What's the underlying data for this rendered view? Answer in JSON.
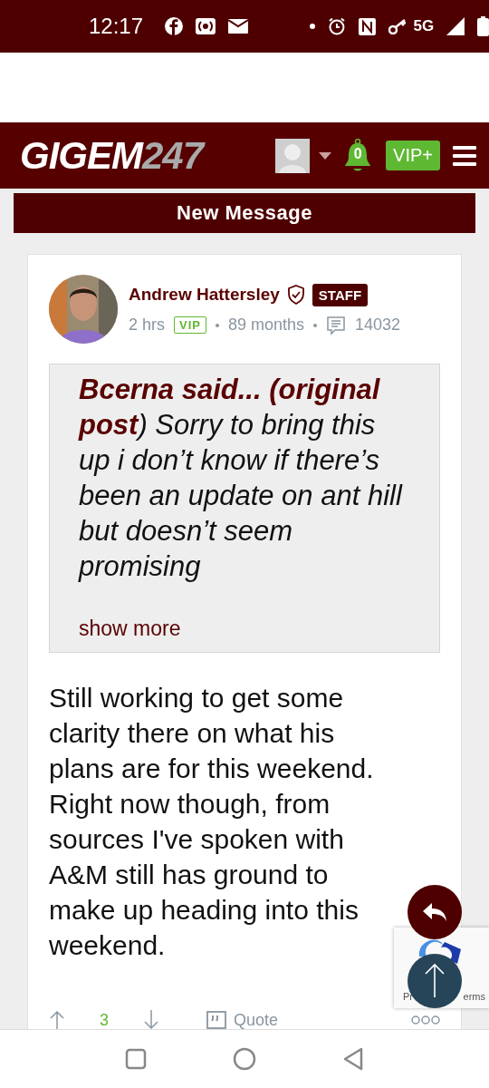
{
  "status_bar": {
    "time": "12:17",
    "network": "5G"
  },
  "header": {
    "logo": {
      "text": "GIGEM",
      "accent": "247"
    },
    "notifications": "0",
    "vip_button": "VIP+"
  },
  "banner": "New Message",
  "post": {
    "author": "Andrew Hattersley",
    "verified": true,
    "badge": "STAFF",
    "time": "2 hrs",
    "vip": "VIP",
    "tenure": "89 months",
    "post_count": "14032",
    "quote": {
      "text": "**Bcerna said... (original post**) Sorry to bring this up i don’t know if there’s been an update on ant hill but doesn’t seem promising",
      "show_more": "show more"
    },
    "body": "Still working to get some clarity there on what his plans are for this weekend. Right now though, from sources I've spoken with A&M still has ground to make up heading into this weekend.",
    "score": "3",
    "quote_button": "Quote"
  },
  "recaptcha": {
    "left_text": "Pr",
    "right_text": "erms"
  }
}
